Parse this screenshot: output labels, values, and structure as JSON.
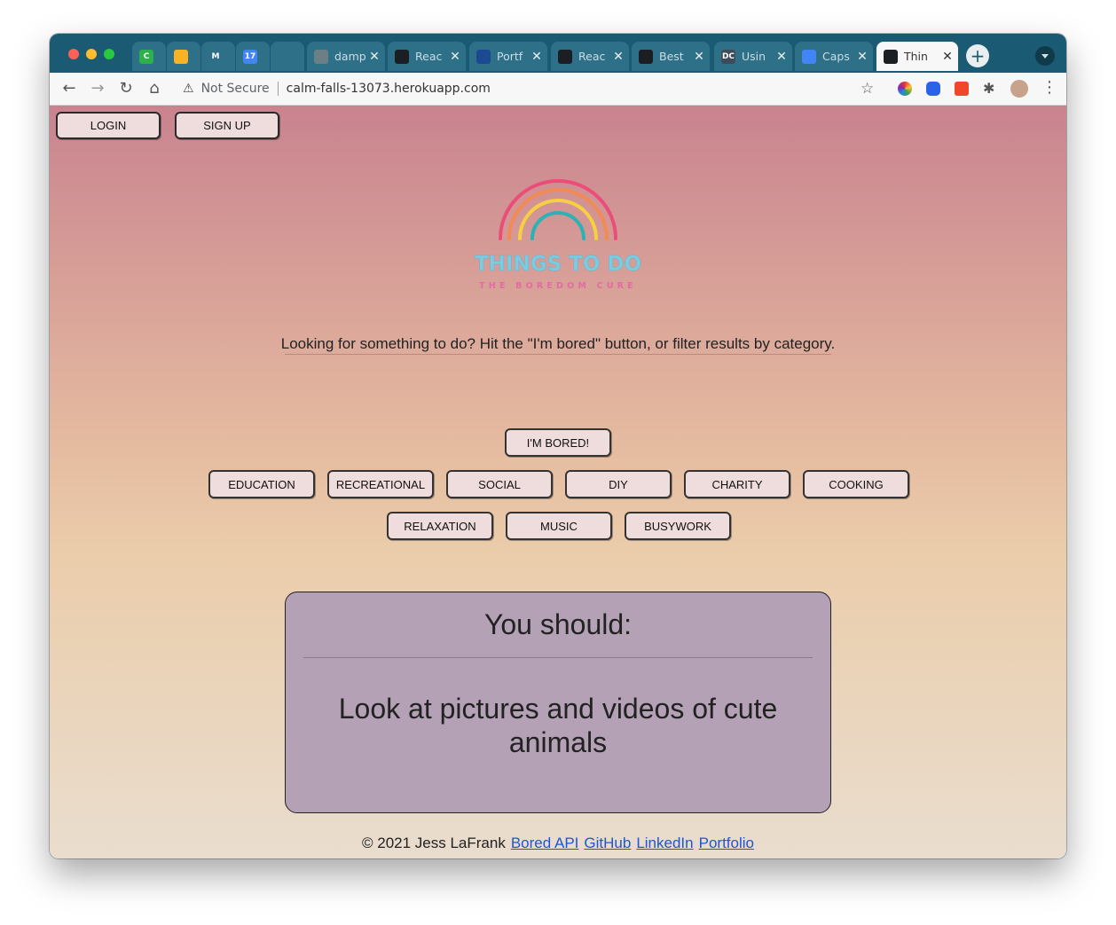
{
  "browser": {
    "tabs": [
      {
        "label": "",
        "fav": "C",
        "fav_color": "#2db14a"
      },
      {
        "label": "",
        "fav": "",
        "fav_color": "#f6b325"
      },
      {
        "label": "",
        "fav": "M",
        "fav_color": "#2e7088"
      },
      {
        "label": "",
        "fav": "17",
        "fav_color": "#4285f4"
      },
      {
        "label": "",
        "fav": "",
        "fav_color": "#2e7088"
      },
      {
        "label": "damp",
        "fav": "",
        "fav_color": "#6b7f87"
      },
      {
        "label": "Reac",
        "fav": "",
        "fav_color": "#1b1f24"
      },
      {
        "label": "Portf",
        "fav": "",
        "fav_color": "#1b4a92"
      },
      {
        "label": "Reac",
        "fav": "",
        "fav_color": "#1b1f24"
      },
      {
        "label": "Best",
        "fav": "",
        "fav_color": "#1b1f24"
      },
      {
        "label": "Usin",
        "fav": "DC",
        "fav_color": "#3e4c59"
      },
      {
        "label": "Caps",
        "fav": "",
        "fav_color": "#4285f4"
      },
      {
        "label": "Thin",
        "fav": "",
        "fav_color": "#1b1f24",
        "active": true
      }
    ],
    "security": "Not Secure",
    "url": "calm-falls-13073.herokuapp.com"
  },
  "auth": {
    "login": "LOGIN",
    "signup": "SIGN UP"
  },
  "logo": {
    "title": "THINGS TO DO",
    "tagline": "THE BOREDOM CURE"
  },
  "intro": "Looking for something to do? Hit the \"I'm bored\" button, or filter results by category.",
  "bored_button": "I'M BORED!",
  "categories_row1": [
    "EDUCATION",
    "RECREATIONAL",
    "SOCIAL",
    "DIY",
    "CHARITY",
    "COOKING"
  ],
  "categories_row2": [
    "RELAXATION",
    "MUSIC",
    "BUSYWORK"
  ],
  "result": {
    "heading": "You should:",
    "activity": "Look at pictures and videos of cute animals"
  },
  "footer": {
    "copyright": "© 2021 Jess LaFrank",
    "links": [
      "Bored API",
      "GitHub",
      "LinkedIn",
      "Portfolio"
    ]
  },
  "colors": {
    "tabstrip": "#1a5a73",
    "button_bg": "#efdcdc",
    "card_bg": "#b4a1b5",
    "link": "#1a56d6",
    "logo_title": "#7ecbe0",
    "logo_tagline": "#e46aa0"
  },
  "icons": [
    "back-arrow-icon",
    "forward-arrow-icon",
    "reload-icon",
    "home-icon",
    "warning-icon",
    "star-icon",
    "extensions-icon",
    "menu-icon"
  ]
}
